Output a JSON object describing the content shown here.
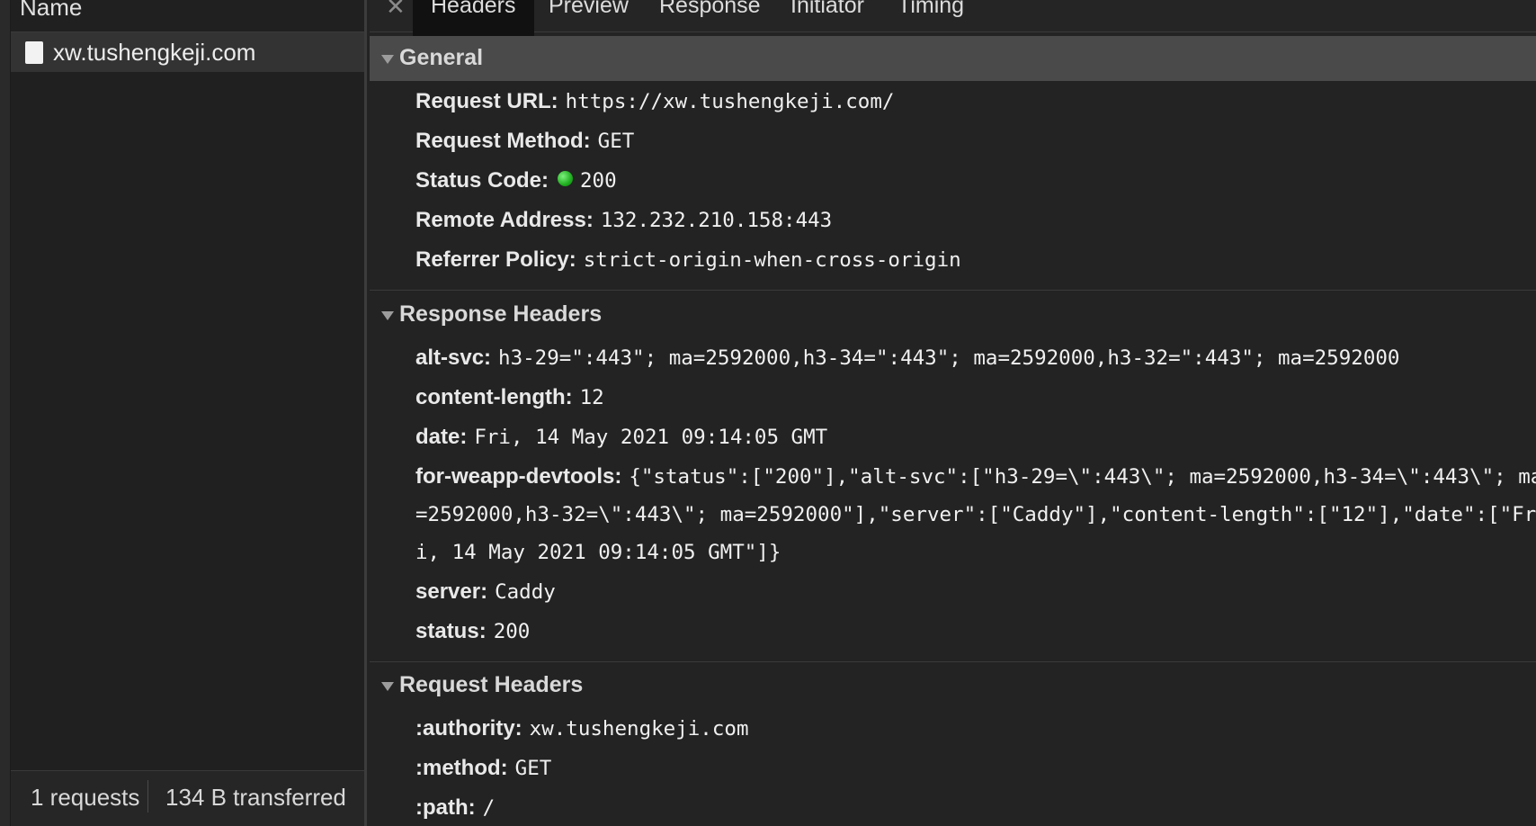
{
  "name_column": {
    "header": "Name",
    "requests": [
      {
        "name": "xw.tushengkeji.com"
      }
    ]
  },
  "status_bar": {
    "requests": "1 requests",
    "transferred": "134 B transferred"
  },
  "tabs": [
    "Headers",
    "Preview",
    "Response",
    "Initiator",
    "Timing"
  ],
  "close_glyph": "✕",
  "general": {
    "title": "General",
    "rows": [
      {
        "key": "Request URL:",
        "value": "https://xw.tushengkeji.com/"
      },
      {
        "key": "Request Method:",
        "value": "GET"
      },
      {
        "key": "Status Code:",
        "value": "200"
      },
      {
        "key": "Remote Address:",
        "value": "132.232.210.158:443"
      },
      {
        "key": "Referrer Policy:",
        "value": "strict-origin-when-cross-origin"
      }
    ]
  },
  "response_headers": {
    "title": "Response Headers",
    "alt_svc": {
      "key": "alt-svc:",
      "value": "h3-29=\":443\"; ma=2592000,h3-34=\":443\"; ma=2592000,h3-32=\":443\"; ma=2592000"
    },
    "content_length": {
      "key": "content-length:",
      "value": "12"
    },
    "date": {
      "key": "date:",
      "value": "Fri, 14 May 2021 09:14:05 GMT"
    },
    "devtools": {
      "key": "for-weapp-devtools:",
      "line1": "{\"status\":[\"200\"],\"alt-svc\":[\"h3-29=\\\":443\\\"; ma=2592000,h3-34=\\\":443\\\"; ma",
      "line2": "=2592000,h3-32=\\\":443\\\"; ma=2592000\"],\"server\":[\"Caddy\"],\"content-length\":[\"12\"],\"date\":[\"Fr",
      "line3": "i, 14 May 2021 09:14:05 GMT\"]}"
    },
    "server": {
      "key": "server:",
      "value": "Caddy"
    },
    "status": {
      "key": "status:",
      "value": "200"
    }
  },
  "request_headers": {
    "title": "Request Headers",
    "rows": [
      {
        "key": ":authority:",
        "value": "xw.tushengkeji.com"
      },
      {
        "key": ":method:",
        "value": "GET"
      },
      {
        "key": ":path:",
        "value": "/"
      }
    ]
  },
  "colors": {
    "status_ok": "#1fae1f",
    "general_header_bg": "#4a4a4a",
    "active_tab_bg": "#111111"
  }
}
